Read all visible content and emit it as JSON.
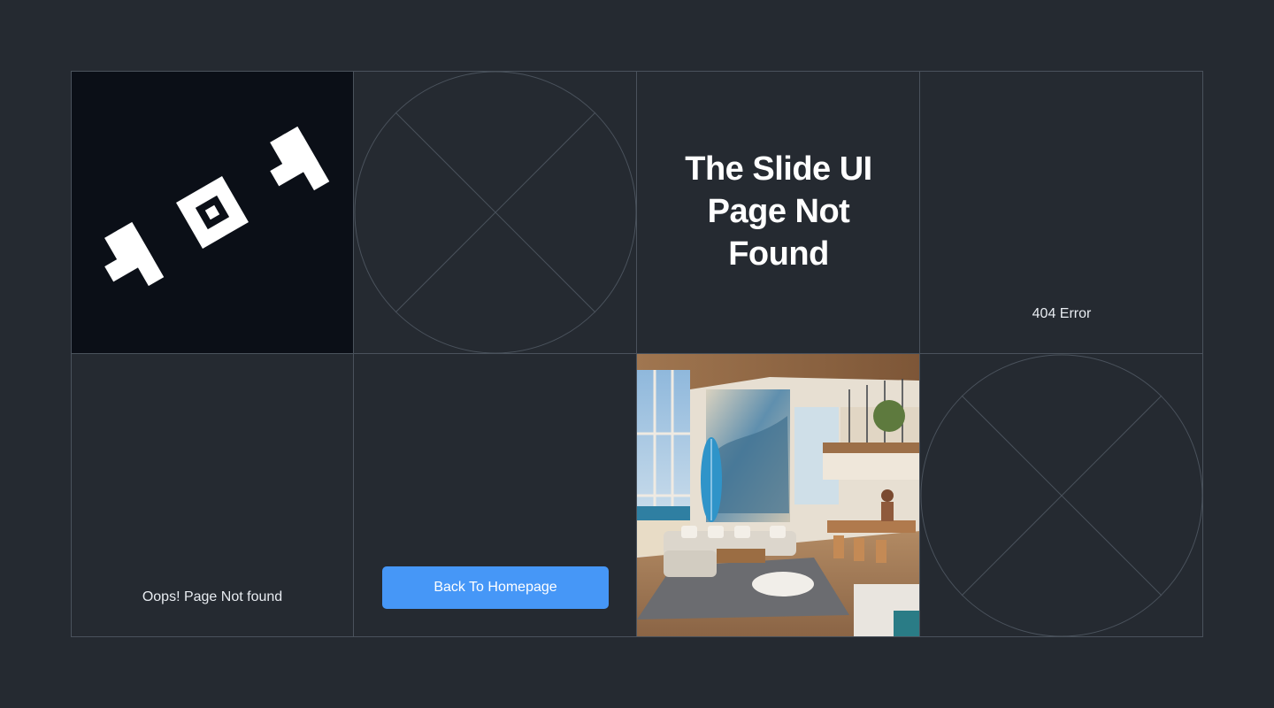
{
  "page": {
    "title_text": "The Slide UI Page Not Found",
    "badge_text": "404",
    "error_label": "404 Error",
    "message": "Oops! Page Not found",
    "back_button_label": "Back To Homepage"
  },
  "icons": {
    "placeholder_1": "image-placeholder-icon",
    "placeholder_2": "image-placeholder-icon"
  },
  "colors": {
    "page_bg": "#252a31",
    "dark_tile_bg": "#0b0f17",
    "grid_line": "#4a525c",
    "button_bg": "#4697f7",
    "text": "#ffffff"
  }
}
